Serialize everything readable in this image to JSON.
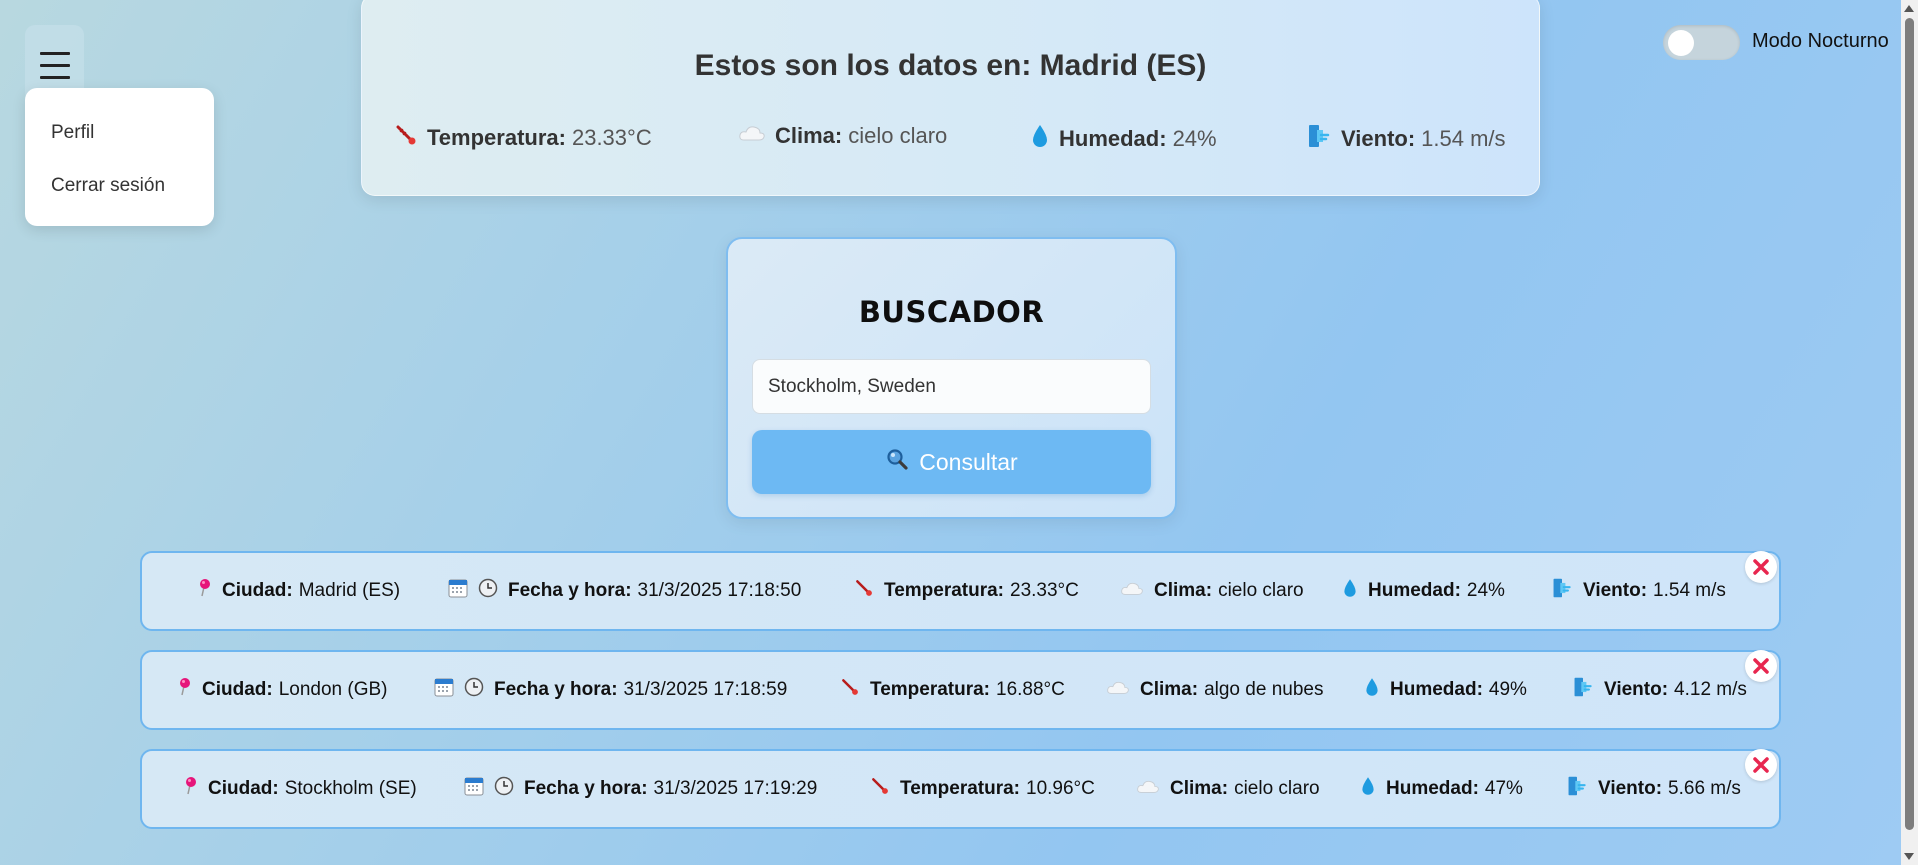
{
  "menu": {
    "items": [
      "Perfil",
      "Cerrar sesión"
    ]
  },
  "current": {
    "title": "Estos son los datos en: Madrid (ES)",
    "stats": [
      {
        "label": "Temperatura:",
        "value": "23.33°C",
        "icon": "thermometer-icon"
      },
      {
        "label": "Clima:",
        "value": "cielo claro",
        "icon": "cloud-icon"
      },
      {
        "label": "Humedad:",
        "value": "24%",
        "icon": "droplet-icon"
      },
      {
        "label": "Viento:",
        "value": "1.54 m/s",
        "icon": "wind-icon"
      }
    ]
  },
  "theme_toggle": {
    "label": "Modo Nocturno",
    "on": false
  },
  "search": {
    "title": "BUSCADOR",
    "value": "Stockholm, Sweden",
    "button_label": "Consultar"
  },
  "labels": {
    "city": "Ciudad:",
    "datetime": "Fecha y hora:",
    "temp": "Temperatura:",
    "weather": "Clima:",
    "humidity": "Humedad:",
    "wind": "Viento:"
  },
  "history": [
    {
      "city": "Madrid (ES)",
      "datetime": "31/3/2025 17:18:50",
      "temp": "23.33°C",
      "weather": "cielo claro",
      "humidity": "24%",
      "wind": "1.54 m/s"
    },
    {
      "city": "London (GB)",
      "datetime": "31/3/2025 17:18:59",
      "temp": "16.88°C",
      "weather": "algo de nubes",
      "humidity": "49%",
      "wind": "4.12 m/s"
    },
    {
      "city": "Stockholm (SE)",
      "datetime": "31/3/2025 17:19:29",
      "temp": "10.96°C",
      "weather": "cielo claro",
      "humidity": "47%",
      "wind": "5.66 m/s"
    }
  ],
  "colors": {
    "accent": "#6db9f3",
    "border": "#6fb6ef",
    "close": "#e8264f"
  }
}
